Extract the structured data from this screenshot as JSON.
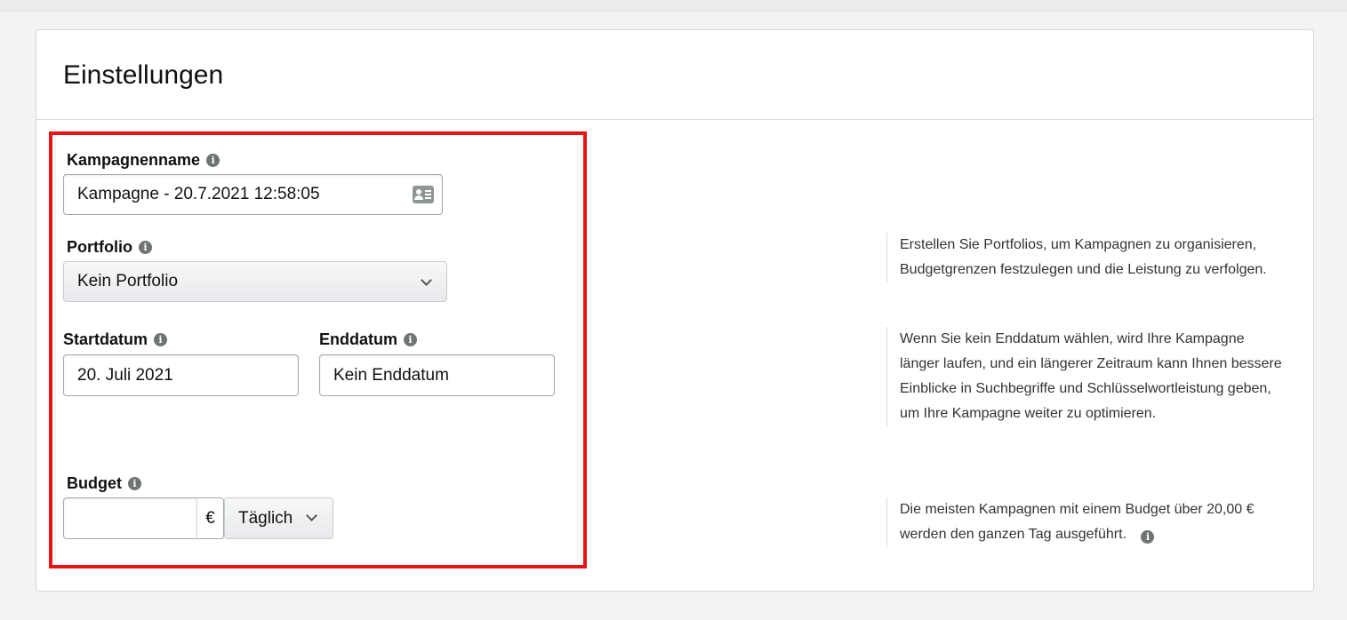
{
  "section": {
    "title": "Einstellungen"
  },
  "campaign_name": {
    "label": "Kampagnenname",
    "value": "Kampagne - 20.7.2021 12:58:05",
    "icon": "contact-card-icon"
  },
  "portfolio": {
    "label": "Portfolio",
    "selected": "Kein Portfolio",
    "help": "Erstellen Sie Portfolios, um Kampagnen zu organisieren, Budgetgrenzen festzulegen und die Leistung zu verfolgen."
  },
  "start_date": {
    "label": "Startdatum",
    "value": "20. Juli 2021"
  },
  "end_date": {
    "label": "Enddatum",
    "value": "Kein Enddatum",
    "help": "Wenn Sie kein Enddatum wählen, wird Ihre Kampagne länger laufen, und ein längerer Zeitraum kann Ihnen bessere Einblicke in Suchbegriffe und Schlüsselwortleistung geben, um Ihre Kampagne weiter zu optimieren."
  },
  "budget": {
    "label": "Budget",
    "value": "",
    "currency": "€",
    "period": "Täglich",
    "help": "Die meisten Kampagnen mit einem Budget über 20,00 € werden den ganzen Tag ausgeführt."
  },
  "colors": {
    "highlight": "#ee1111",
    "info_icon": "#6f7373"
  }
}
